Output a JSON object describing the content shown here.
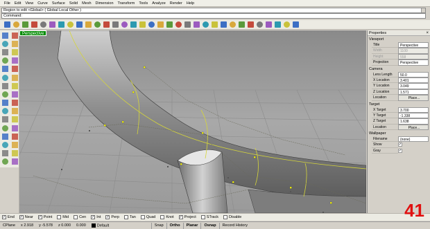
{
  "menubar": {
    "items": [
      "File",
      "Edit",
      "View",
      "Curve",
      "Surface",
      "Solid",
      "Mesh",
      "Dimension",
      "Transform",
      "Tools",
      "Analyze",
      "Render",
      "Help"
    ]
  },
  "command": {
    "history": "Region to edit <Global> ( Global  Local  Other )",
    "prompt": "Command:"
  },
  "viewport": {
    "label": "Perspective"
  },
  "properties": {
    "title": "Properties",
    "close": "×",
    "viewport_section": "Viewport",
    "viewport_rows": [
      {
        "label": "Title",
        "value": "Perspective",
        "disabled": false
      },
      {
        "label": "Width",
        "value": "1100",
        "disabled": true
      },
      {
        "label": "Height",
        "value": "558",
        "disabled": true
      },
      {
        "label": "Projection",
        "value": "Perspective",
        "disabled": false
      }
    ],
    "camera_section": "Camera",
    "camera_rows": [
      {
        "label": "Lens Length",
        "value": "50.0"
      },
      {
        "label": "X Location",
        "value": "3.401"
      },
      {
        "label": "Y Location",
        "value": "3.049"
      },
      {
        "label": "Z Location",
        "value": "1.571"
      },
      {
        "label": "Location",
        "value": "Place..."
      }
    ],
    "target_section": "Target",
    "target_rows": [
      {
        "label": "X Target",
        "value": "3.700"
      },
      {
        "label": "Y Target",
        "value": "-1.338"
      },
      {
        "label": "Z Target",
        "value": "1.638"
      },
      {
        "label": "Location",
        "value": "Place..."
      }
    ],
    "wallpaper_section": "Wallpaper",
    "wallpaper_rows": [
      {
        "label": "Filename",
        "value": "(none)"
      },
      {
        "label": "Show",
        "value": "✓"
      },
      {
        "label": "Gray",
        "value": "✓"
      }
    ]
  },
  "osnap": {
    "items": [
      {
        "label": "End",
        "checked": true
      },
      {
        "label": "Near",
        "checked": true
      },
      {
        "label": "Point",
        "checked": true
      },
      {
        "label": "Mid",
        "checked": false
      },
      {
        "label": "Cen",
        "checked": false
      },
      {
        "label": "Int",
        "checked": true
      },
      {
        "label": "Perp",
        "checked": true
      },
      {
        "label": "Tan",
        "checked": false
      },
      {
        "label": "Quad",
        "checked": false
      },
      {
        "label": "Knot",
        "checked": false
      },
      {
        "label": "Project",
        "checked": true
      },
      {
        "label": "STrack",
        "checked": false
      },
      {
        "label": "Disable",
        "checked": false
      }
    ]
  },
  "status": {
    "cplane": "CPlane",
    "x": "x 2.918",
    "y": "y -5.578",
    "z": "z 0.000",
    "units": "0.000",
    "layer": "Default",
    "snap": "Snap",
    "ortho": "Ortho",
    "planar": "Planar",
    "osnap": "Osnap",
    "record": "Record History"
  },
  "overlay_number": "41",
  "colors": {
    "viewport_bg": "#9b9b9b",
    "viewport_label_bg": "#008a00",
    "overlay_number": "#e01010",
    "control_points": "#ffff00"
  },
  "toolbar_icons": [
    "new-icon",
    "open-icon",
    "save-icon",
    "print-icon",
    "import-icon",
    "cut-icon",
    "copy-icon",
    "paste-icon",
    "undo-icon",
    "redo-icon",
    "pan-icon",
    "rotate-view-icon",
    "zoom-icon",
    "zoom-window-icon",
    "zoom-extents-icon",
    "zoom-selected-icon",
    "viewport-layout-icon",
    "four-views-icon",
    "grid-icon",
    "select-icon",
    "layers-icon",
    "properties-icon",
    "snap-icon",
    "light-icon",
    "wireframe-icon",
    "shaded-icon",
    "rendered-icon",
    "render-icon",
    "material-icon",
    "environment-icon",
    "sun-icon",
    "options-icon",
    "help-icon"
  ],
  "left_icons": [
    "select-arrow-icon",
    "point-icon",
    "curve-icon",
    "polyline-icon",
    "circle-icon",
    "arc-icon",
    "ellipse-icon",
    "rectangle-icon",
    "polygon-icon",
    "freeform-icon",
    "fillet-curve-icon",
    "offset-icon",
    "surface-icon",
    "loft-icon",
    "extrude-icon",
    "revolve-icon",
    "solid-box-icon",
    "sphere-icon",
    "cylinder-icon",
    "boolean-icon",
    "mesh-icon",
    "text-icon",
    "dimension-icon",
    "group-icon",
    "trim-icon",
    "split-icon",
    "join-icon",
    "explode-icon",
    "move-icon",
    "copy-object-icon",
    "rotate-icon",
    "scale-icon"
  ]
}
